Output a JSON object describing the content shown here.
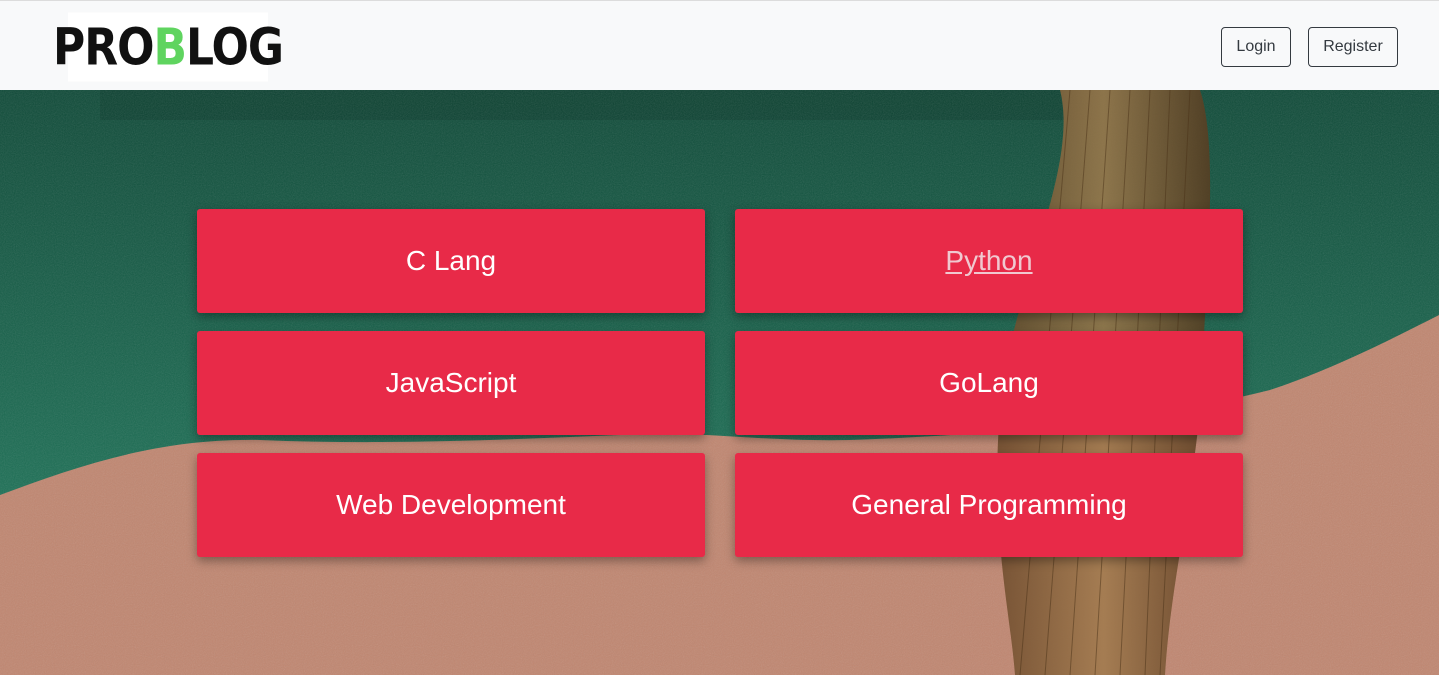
{
  "navbar": {
    "logo": {
      "part1": "PRO",
      "accent": "B",
      "part2": "LOG"
    },
    "login_label": "Login",
    "register_label": "Register"
  },
  "categories": [
    {
      "label": "C Lang"
    },
    {
      "label": "Python",
      "hovered": true
    },
    {
      "label": "JavaScript"
    },
    {
      "label": "GoLang"
    },
    {
      "label": "Web Development"
    },
    {
      "label": "General Programming"
    }
  ],
  "colors": {
    "navbar_bg": "#f8f9fa",
    "card_bg": "#e82a48",
    "hero_green": "#1b6b52",
    "hero_tan": "#c08670",
    "logo_accent": "#5fd45f"
  }
}
